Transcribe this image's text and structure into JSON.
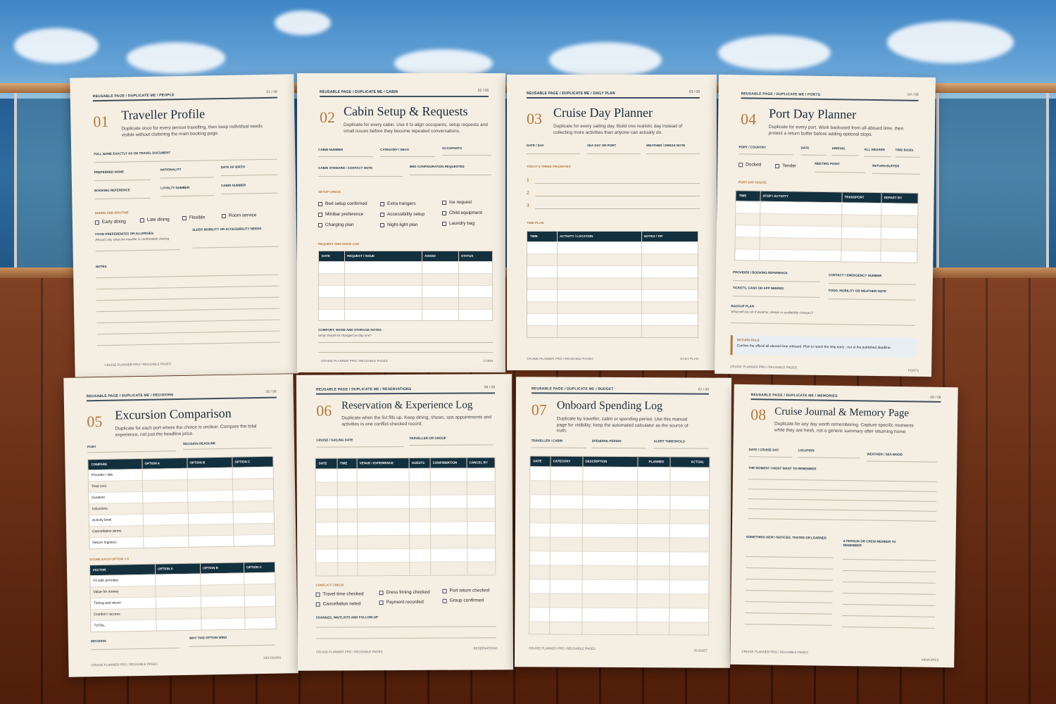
{
  "pages": [
    {
      "breadcrumb": "REUSABLE PAGE / DUPLICATE ME / PEOPLE",
      "page": "01 / 08",
      "num": "01",
      "title": "Traveller Profile",
      "desc": "Duplicate once for every person travelling, then keep individual needs visible without cluttering the main booking page.",
      "f1": "FULL NAME EXACTLY AS ON TRAVEL DOCUMENT",
      "f2": "PREFERRED NAME",
      "f3": "NATIONALITY",
      "f4": "DATE OF BIRTH",
      "f5": "BOOKING REFERENCE",
      "f6": "LOYALTY NUMBER",
      "f7": "CABIN NUMBER",
      "sec": "DINING AND ROUTINE",
      "c1": "Early dining",
      "c2": "Late dining",
      "c3": "Flexible",
      "c4": "Room service",
      "f8": "FOOD PREFERENCES OR ALLERGIES",
      "f8i": "Record only what the traveller is comfortable sharing.",
      "f9": "SLEEP, MOBILITY OR ACCESSIBILITY NEEDS",
      "notes": "NOTES",
      "footer": "CRUISE PLANNER PRO / REUSABLE PAGES"
    },
    {
      "breadcrumb": "REUSABLE PAGE / DUPLICATE ME / CABIN",
      "page": "02 / 08",
      "num": "02",
      "title": "Cabin Setup & Requests",
      "desc": "Duplicate for every cabin. Use it to align occupants, setup requests and small issues before they become repeated conversations.",
      "f1": "CABIN NUMBER",
      "f2": "CATEGORY / DECK",
      "f3": "OCCUPANTS",
      "f4": "CABIN STEWARD / CONTACT NOTE",
      "f5": "BED CONFIGURATION REQUESTED",
      "sec": "SETUP CHECK",
      "c1": "Bed setup confirmed",
      "c2": "Extra hangers",
      "c3": "Ice request",
      "c4": "Minibar preference",
      "c5": "Accessibility setup",
      "c6": "Child equipment",
      "c7": "Charging plan",
      "c8": "Night-light plan",
      "c9": "Laundry bag",
      "sec2": "REQUEST AND ISSUE LOG",
      "th": [
        "DATE",
        "REQUEST / ISSUE",
        "ASKED",
        "STATUS"
      ],
      "f6": "COMFORT, NOISE AND STORAGE NOTES",
      "f6i": "What should be changed on day one?",
      "footer": "CRUISE PLANNER PRO / REUSABLE PAGES",
      "footer_r": "CABIN"
    },
    {
      "breadcrumb": "REUSABLE PAGE / DUPLICATE ME / DAILY PLAN",
      "page": "03 / 08",
      "num": "03",
      "title": "Cruise Day Planner",
      "desc": "Duplicate for every sailing day. Build one realistic day instead of collecting more activities than anyone can actually do.",
      "f1": "DATE / DAY",
      "f2": "SEA DAY OR PORT",
      "f3": "WEATHER / DRESS NOTE",
      "sec": "TODAY'S THREE PRIORITIES",
      "p1": "1",
      "p2": "2",
      "p3": "3",
      "sec2": "TIME PLAN",
      "th": [
        "TIME",
        "ACTIVITY / LOCATION",
        "NOTES / TIP"
      ],
      "footer": "CRUISE PLANNER PRO / REUSABLE PAGES",
      "footer_r": "DAILY PLAN"
    },
    {
      "breadcrumb": "REUSABLE PAGE / DUPLICATE ME / PORTS",
      "page": "04 / 08",
      "num": "04",
      "title": "Port Day Planner",
      "desc": "Duplicate for every port. Work backward from all-aboard time, then protect a return buffer before adding optional stops.",
      "f1": "PORT / COUNTRY",
      "f2": "DATE",
      "f3": "ARRIVAL",
      "f4": "ALL ABOARD",
      "f5": "TIME BASIS",
      "c1": "Docked",
      "c2": "Tender",
      "f6": "MEETING POINT",
      "f7": "RETURN BUFFER",
      "sec": "PORT-DAY ROUTE",
      "th": [
        "TIME",
        "STOP / ACTIVITY",
        "TRANSPORT",
        "DEPART BY"
      ],
      "f8": "PROVIDER / BOOKING REFERENCE",
      "f9": "CONTACT / EMERGENCY NUMBER",
      "f10": "TICKETS, CASH OR APP NEEDED",
      "f11": "FOOD, MOBILITY OR WEATHER NOTE",
      "f12": "BACKUP PLAN",
      "f12i": "What will you do if weather, delays or availability changes?",
      "rr": "RETURN RULE",
      "rrt": "Confirm the official all-aboard time onboard. Plan to reach the ship early - not at the published deadline.",
      "footer": "CRUISE PLANNER PRO / REUSABLE PAGES",
      "footer_r": "PORTS"
    },
    {
      "breadcrumb": "REUSABLE PAGE / DUPLICATE ME / DECISIONS",
      "page": "05 / 08",
      "num": "05",
      "title": "Excursion Comparison",
      "desc": "Duplicate for each port where the choice is unclear. Compare the total experience, not just the headline price.",
      "f1": "PORT",
      "f2": "DECISION DEADLINE",
      "th": [
        "COMPARE",
        "OPTION A",
        "OPTION B",
        "OPTION C"
      ],
      "rows": [
        "Provider / title",
        "Total cost",
        "Duration",
        "Inclusions",
        "Activity level",
        "Cancellation terms",
        "Return logistics"
      ],
      "sec": "SCORE EACH OPTION 1-5",
      "th2": [
        "FACTOR",
        "OPTION A",
        "OPTION B",
        "OPTION C"
      ],
      "rows2": [
        "Fit with priorities",
        "Value for money",
        "Timing and return",
        "Comfort / access",
        "TOTAL"
      ],
      "f3": "DECISION",
      "f4": "WHY THIS OPTION WINS",
      "footer": "CRUISE PLANNER PRO / REUSABLE PAGES",
      "footer_r": "DECISIONS"
    },
    {
      "breadcrumb": "REUSABLE PAGE / DUPLICATE ME / RESERVATIONS",
      "page": "06 / 08",
      "num": "06",
      "title": "Reservation & Experience Log",
      "desc": "Duplicate when the list fills up. Keep dining, shows, spa appointments and activities in one conflict-checked record.",
      "f1": "CRUISE / SAILING DATE",
      "f2": "TRAVELLER OR GROUP",
      "th": [
        "DATE",
        "TIME",
        "VENUE / EXPERIENCE",
        "GUESTS",
        "CONFIRMATION",
        "CANCEL BY"
      ],
      "sec": "CONFLICT CHECK",
      "c1": "Travel time checked",
      "c2": "Dress timing checked",
      "c3": "Port return checked",
      "c4": "Cancellation noted",
      "c5": "Payment recorded",
      "c6": "Group confirmed",
      "f3": "CHANGES, WAITLISTS AND FOLLOW-UP",
      "footer": "CRUISE PLANNER PRO / REUSABLE PAGES",
      "footer_r": "RESERVATIONS"
    },
    {
      "breadcrumb": "REUSABLE PAGE / DUPLICATE ME / BUDGET",
      "page": "07 / 08",
      "num": "07",
      "title": "Onboard Spending Log",
      "desc": "Duplicate by traveller, cabin or spending period. Use this manual page for visibility; keep the automated calculator as the source of truth.",
      "f1": "TRAVELLER / CABIN",
      "f2": "SPENDING PERIOD",
      "f3": "ALERT THRESHOLD",
      "th": [
        "DATE",
        "CATEGORY",
        "DESCRIPTION",
        "PLANNED",
        "ACTUAL"
      ],
      "footer": "CRUISE PLANNER PRO / REUSABLE PAGES",
      "footer_r": "BUDGET"
    },
    {
      "breadcrumb": "REUSABLE PAGE / DUPLICATE ME / MEMORIES",
      "page": "08 / 08",
      "num": "08",
      "title": "Cruise Journal & Memory Page",
      "desc": "Duplicate for any day worth remembering. Capture specific moments while they are fresh, not a generic summary after returning home.",
      "f1": "DATE / CRUISE DAY",
      "f2": "LOCATION",
      "f3": "WEATHER / SEA MOOD",
      "f4": "THE MOMENT I MOST WANT TO REMEMBER",
      "f5": "SOMETHING NEW I NOTICED, TASTED OR LEARNED",
      "f6": "A PERSON OR CREW MEMBER TO REMEMBER",
      "footer": "CRUISE PLANNER PRO / REUSABLE PAGES",
      "footer_r": "MEMORIES"
    }
  ]
}
